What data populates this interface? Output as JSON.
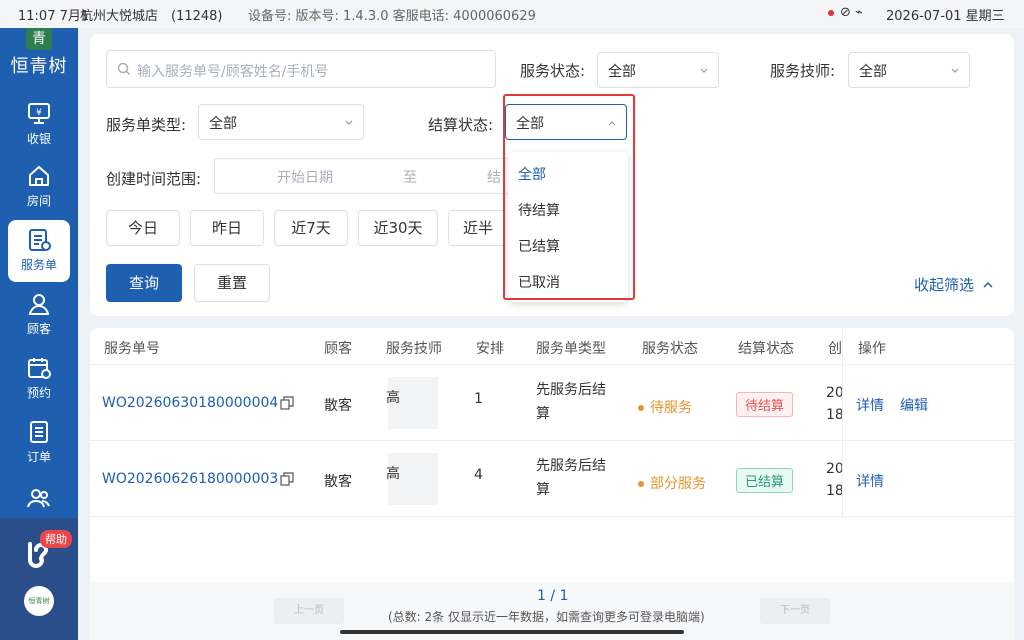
{
  "status_bar": {
    "time": "11:07",
    "date_short": "7月1",
    "shop": "杭州大悦城店　(11248)",
    "device": "设备号: 版本号: 1.4.3.0  客服电话: 4000060629",
    "datetime": "2026-07-01 星期三"
  },
  "sidebar": {
    "logo_mark": "青",
    "logo_text": "恒青树",
    "items": [
      {
        "label": "收银",
        "icon": "cashier-icon"
      },
      {
        "label": "房间",
        "icon": "home-icon"
      },
      {
        "label": "服务单",
        "icon": "service-order-icon"
      },
      {
        "label": "顾客",
        "icon": "customer-icon"
      },
      {
        "label": "预约",
        "icon": "calendar-icon"
      },
      {
        "label": "订单",
        "icon": "order-icon"
      },
      {
        "label": "",
        "icon": "staff-icon"
      }
    ],
    "help_badge": "帮助",
    "bottom_logo": "恒青树"
  },
  "filters": {
    "search_placeholder": "输入服务单号/顾客姓名/手机号",
    "service_status_label": "服务状态:",
    "service_status_value": "全部",
    "technician_label": "服务技师:",
    "technician_value": "全部",
    "order_type_label": "服务单类型:",
    "order_type_value": "全部",
    "settle_status_label": "结算状态:",
    "settle_status_value": "全部",
    "time_range_label": "创建时间范围:",
    "start_date_placeholder": "开始日期",
    "range_sep": "至",
    "end_date_placeholder": "结",
    "quick_ranges": [
      "今日",
      "昨日",
      "近7天",
      "近30天",
      "近半年"
    ],
    "query_button": "查询",
    "reset_button": "重置",
    "collapse_label": "收起筛选"
  },
  "settle_dropdown": {
    "options": [
      "全部",
      "待结算",
      "已结算",
      "已取消"
    ],
    "selected": "全部"
  },
  "table": {
    "headers": [
      "服务单号",
      "顾客",
      "服务技师",
      "安排",
      "服务单类型",
      "服务状态",
      "结算状态",
      "创",
      "操作"
    ],
    "rows": [
      {
        "order_no": "WO20260630180000004",
        "customer": "散客",
        "technician": "高",
        "arrange": "1",
        "type_line1": "先服务后结",
        "type_line2": "算",
        "service_status": "待服务",
        "settle_status": "待结算",
        "created_line1": "20",
        "created_line2": "18",
        "actions": [
          "详情",
          "编辑"
        ]
      },
      {
        "order_no": "WO20260626180000003",
        "customer": "散客",
        "technician": "高",
        "arrange": "4",
        "type_line1": "先服务后结",
        "type_line2": "算",
        "service_status": "部分服务",
        "settle_status": "已结算",
        "created_line1": "20",
        "created_line2": "18",
        "actions": [
          "详情"
        ]
      }
    ]
  },
  "pager": {
    "prev": "上一页",
    "next": "下一页",
    "page_info": "1 / 1",
    "note": "(总数: 2条 仅显示近一年数据，如需查询更多可登录电脑端)"
  },
  "colors": {
    "brand": "#1e5fb0",
    "highlight_frame": "#e23a3a",
    "pending": "#e15254",
    "settled": "#1f9d78",
    "in_progress": "#e9942b"
  }
}
